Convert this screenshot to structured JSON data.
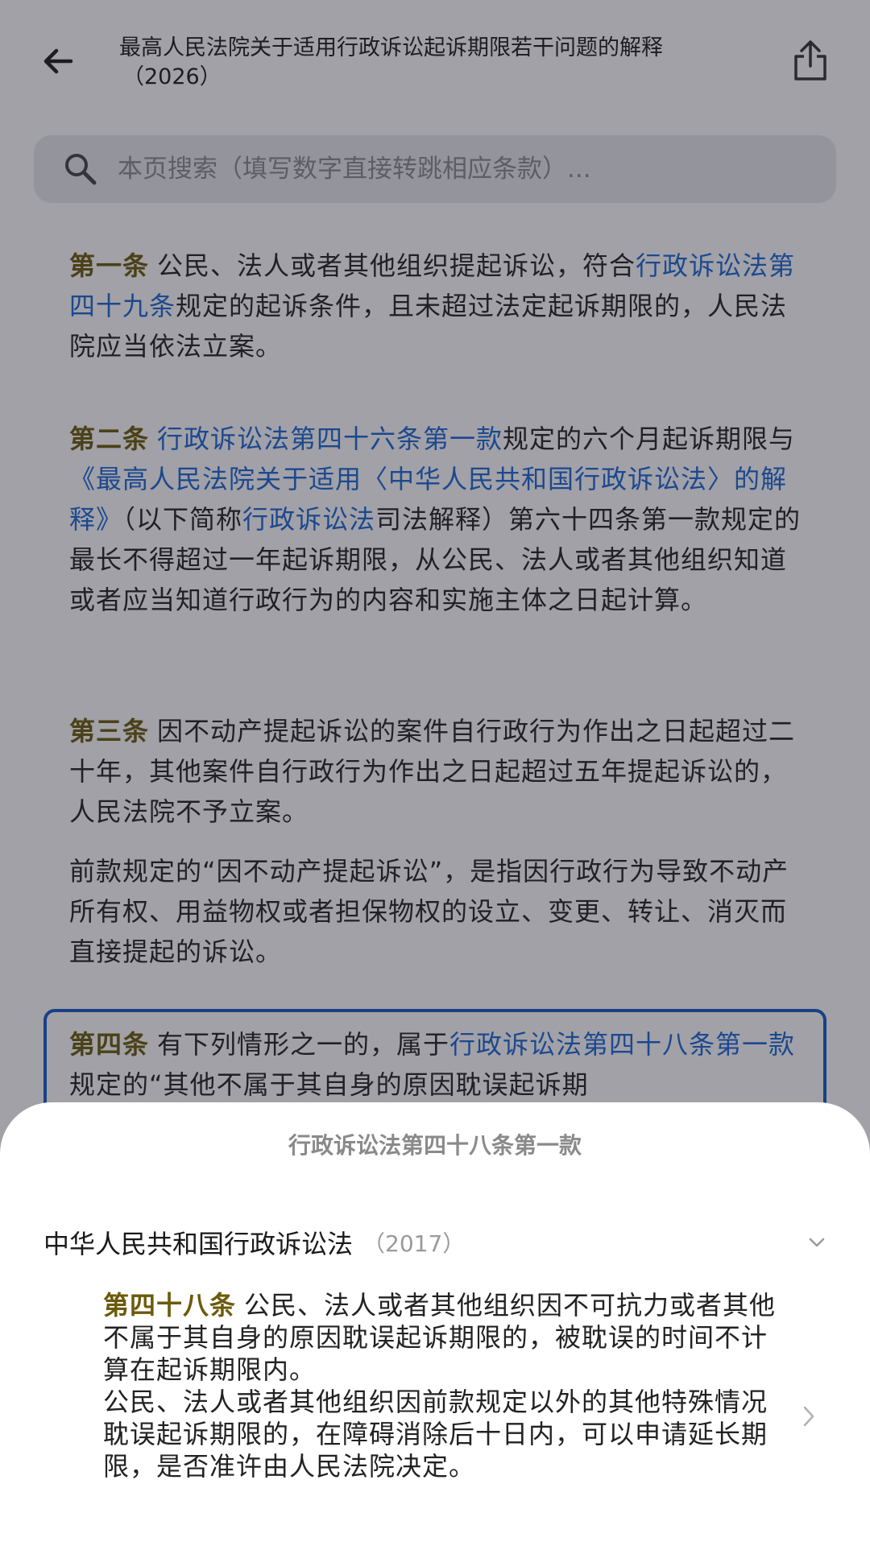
{
  "header": {
    "title_line1": "最高人民法院关于适用行政诉讼起诉期限若干问题的解释",
    "title_line2": "（2026）"
  },
  "search": {
    "placeholder": "本页搜索（填写数字直接转跳相应条款）..."
  },
  "articles": [
    {
      "title": "第一条",
      "text1": "公民、法人或者其他组织提起诉讼，符合",
      "link1": "行政诉讼法第四十九条",
      "text2": "规定的起诉条件，且未超过法定起诉期限的，人民法院应当依法立案。"
    },
    {
      "title": "第二条",
      "link1": "行政诉讼法第四十六条第一款",
      "text1": "规定的六个月起诉期限与",
      "link2": "《最高人民法院关于适用〈中华人民共和国行政诉讼法〉的解释》",
      "text2": "（以下简称",
      "link3": "行政诉讼法",
      "text3": "司法解释）第六十四条第一款规定的最长不得超过一年起诉期限，从公民、法人或者其他组织知道或者应当知道行政行为的内容和实施主体之日起计算。"
    },
    {
      "title": "第三条",
      "text1": "因不动产提起诉讼的案件自行政行为作出之日起超过二十年，其他案件自行政行为作出之日起超过五年提起诉讼的，人民法院不予立案。",
      "para2": "前款规定的“因不动产提起诉讼”，是指因行政行为导致不动产所有权、用益物权或者担保物权的设立、变更、转让、消灭而直接提起的诉讼。"
    },
    {
      "title": "第四条",
      "text1": "有下列情形之一的，属于",
      "link1": "行政诉讼法第四十八条第一款",
      "text2": "规定的“其他不属于其自身的原因耽误起诉期"
    }
  ],
  "sheet": {
    "title": "行政诉讼法第四十八条第一款",
    "law_name": "中华人民共和国行政诉讼法",
    "law_year": "（2017）",
    "article_title": "第四十八条",
    "article_text1": "公民、法人或者其他组织因不可抗力或者其他不属于其自身的原因耽误起诉期限的，被耽误的时间不计算在起诉期限内。",
    "article_text2": "公民、法人或者其他组织因前款规定以外的其他特殊情况耽误起诉期限的，在障碍消除后十日内，可以申请延长期限，是否准许由人民法院决定。"
  },
  "icons": {
    "back": "arrow-left-icon",
    "share": "share-icon",
    "search": "search-icon",
    "expand": "chevron-down-icon",
    "open": "chevron-right-icon"
  },
  "colors": {
    "article_title": "#6b5a0a",
    "link": "#1a66d6",
    "highlight_border": "#1559c4"
  }
}
